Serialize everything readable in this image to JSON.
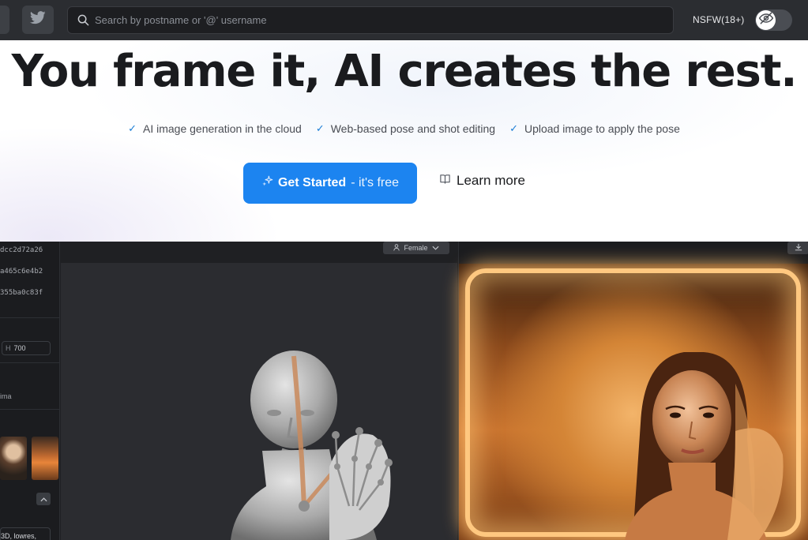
{
  "topbar": {
    "search_placeholder": "Search by postname or '@' username",
    "nsfw_label": "NSFW(18+)",
    "nsfw_enabled": false,
    "icons": [
      "twitter-icon",
      "search-icon",
      "eye-off-icon"
    ]
  },
  "hero": {
    "headline": "You frame it, AI creates the rest.",
    "features": [
      "AI image generation in the cloud",
      "Web-based pose and shot editing",
      "Upload image to apply the pose"
    ],
    "cta_main": "Get Started",
    "cta_sub": "- it's free",
    "learn_more": "Learn more",
    "accent_color": "#1c84f0"
  },
  "preview": {
    "hashes": [
      "dcc2d72a26",
      "a465c6e4b2",
      "355ba0c83f"
    ],
    "height_label": "H",
    "height_value": "700",
    "side_text": "ima",
    "gender_select": "Female",
    "prompt_text": "3D, lowres,"
  }
}
